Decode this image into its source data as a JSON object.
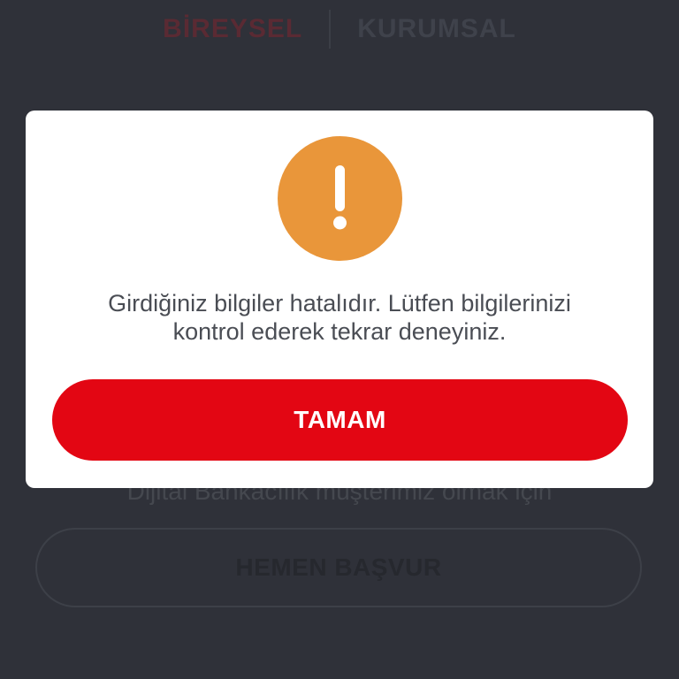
{
  "background": {
    "tabs": [
      {
        "label": "BİREYSEL",
        "active": true
      },
      {
        "label": "KURUMSAL",
        "active": false
      }
    ],
    "info_text": "Dijital Bankacılık müşterimiz olmak için",
    "apply_button_label": "HEMEN BAŞVUR"
  },
  "dialog": {
    "icon": "exclamation-warning-icon",
    "message_line1": "Girdiğiniz bilgiler hatalıdır. Lütfen bilgilerinizi",
    "message_line2": "kontrol ederek tekrar deneyiniz.",
    "ok_label": "TAMAM"
  },
  "colors": {
    "background": "#2f3139",
    "dialog": "#ffffff",
    "warning": "#e9963a",
    "primary_button": "#e30613"
  }
}
